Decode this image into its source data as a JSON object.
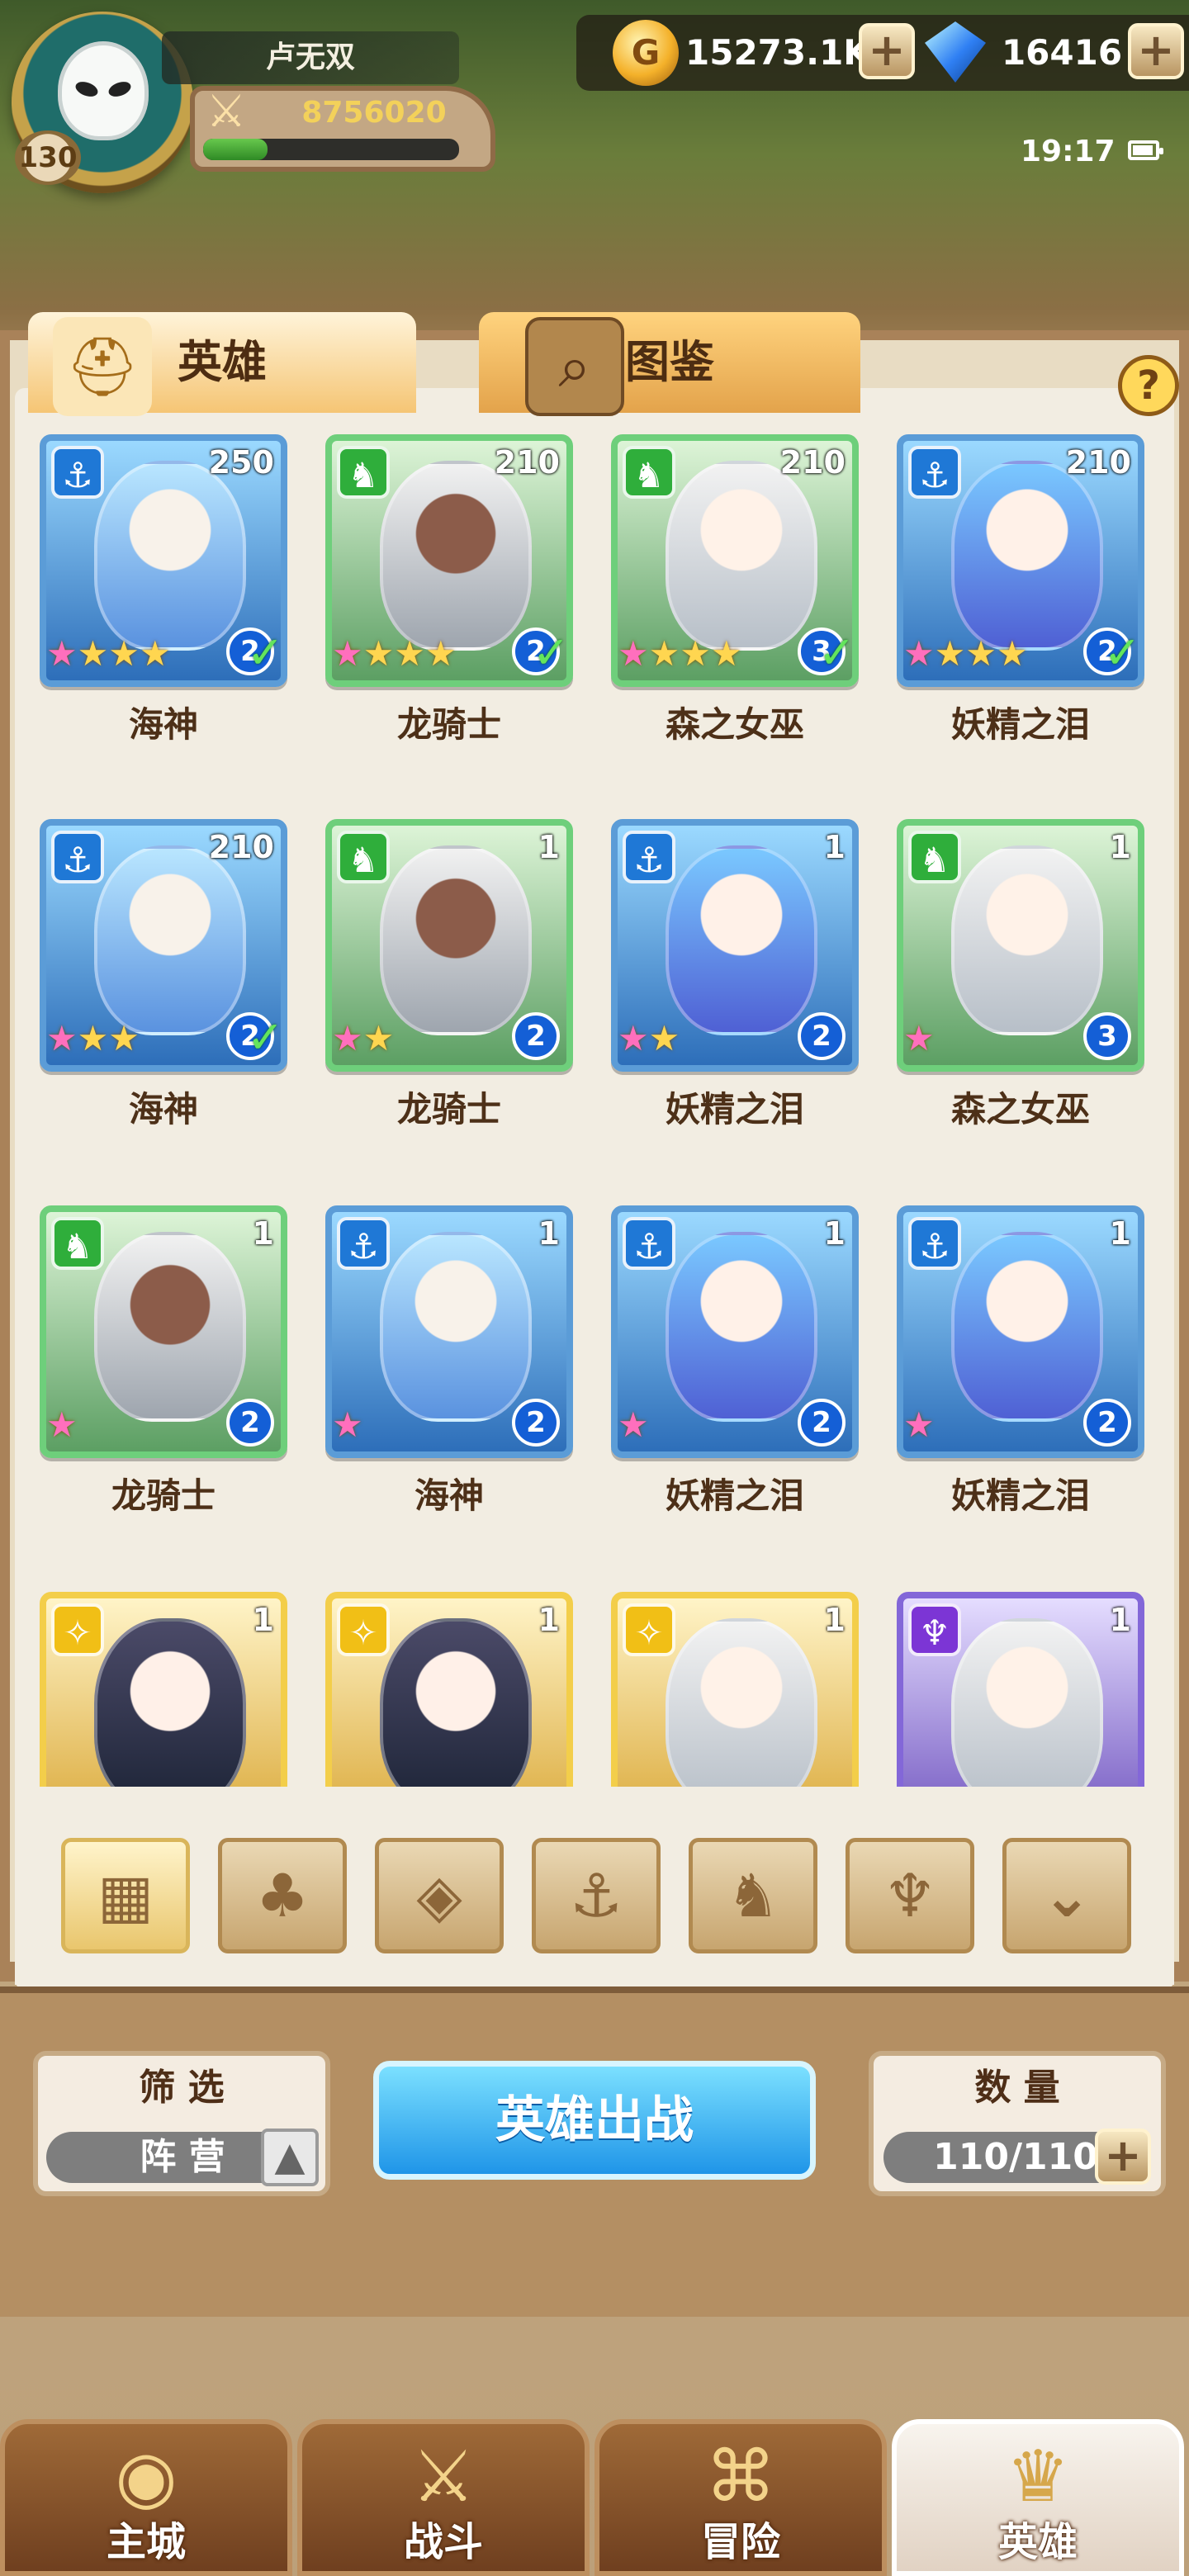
{
  "player": {
    "name": "卢无双",
    "level": "130",
    "power": "8756020",
    "experience_progress": 0.25
  },
  "resources": {
    "gold": "15273.1K",
    "gems": "16416"
  },
  "status": {
    "time": "19:17"
  },
  "tabs": [
    {
      "label": "英雄",
      "active": true
    },
    {
      "label": "图鉴",
      "active": false
    }
  ],
  "heroes": [
    {
      "name": "海神",
      "level": "250",
      "stars": 4,
      "rank": "2",
      "faction": "anchor",
      "checked": true,
      "theme": "blue"
    },
    {
      "name": "龙骑士",
      "level": "210",
      "stars": 4,
      "rank": "2",
      "faction": "beast",
      "checked": true,
      "theme": "dark"
    },
    {
      "name": "森之女巫",
      "level": "210",
      "stars": 4,
      "rank": "3",
      "faction": "beast",
      "checked": true,
      "theme": "white"
    },
    {
      "name": "妖精之泪",
      "level": "210",
      "stars": 4,
      "rank": "2",
      "faction": "anchor",
      "checked": true,
      "theme": "pink"
    },
    {
      "name": "海神",
      "level": "210",
      "stars": 3,
      "rank": "2",
      "faction": "anchor",
      "checked": true,
      "theme": "blue"
    },
    {
      "name": "龙骑士",
      "level": "1",
      "stars": 2,
      "rank": "2",
      "faction": "beast",
      "checked": false,
      "theme": "dark"
    },
    {
      "name": "妖精之泪",
      "level": "1",
      "stars": 2,
      "rank": "2",
      "faction": "anchor",
      "checked": false,
      "theme": "pink"
    },
    {
      "name": "森之女巫",
      "level": "1",
      "stars": 1,
      "rank": "3",
      "faction": "beast",
      "checked": false,
      "theme": "white"
    },
    {
      "name": "龙骑士",
      "level": "1",
      "stars": 1,
      "rank": "2",
      "faction": "beast",
      "checked": false,
      "theme": "dark"
    },
    {
      "name": "海神",
      "level": "1",
      "stars": 1,
      "rank": "2",
      "faction": "anchor",
      "checked": false,
      "theme": "blue"
    },
    {
      "name": "妖精之泪",
      "level": "1",
      "stars": 1,
      "rank": "2",
      "faction": "anchor",
      "checked": false,
      "theme": "pink"
    },
    {
      "name": "妖精之泪",
      "level": "1",
      "stars": 1,
      "rank": "2",
      "faction": "anchor",
      "checked": false,
      "theme": "pink"
    },
    {
      "name": "",
      "level": "1",
      "stars": 0,
      "rank": "",
      "faction": "light",
      "checked": false,
      "theme": "green"
    },
    {
      "name": "",
      "level": "1",
      "stars": 0,
      "rank": "",
      "faction": "light",
      "checked": false,
      "theme": "green"
    },
    {
      "name": "",
      "level": "1",
      "stars": 0,
      "rank": "",
      "faction": "light",
      "checked": false,
      "theme": "white"
    },
    {
      "name": "",
      "level": "1",
      "stars": 0,
      "rank": "",
      "faction": "dark",
      "checked": false,
      "theme": "white"
    }
  ],
  "filter_buttons": [
    {
      "icon": "grid-icon",
      "symbol": "▦",
      "active": true
    },
    {
      "icon": "leaf-icon",
      "symbol": "♣",
      "active": false
    },
    {
      "icon": "diamond-icon",
      "symbol": "◈",
      "active": false
    },
    {
      "icon": "anchor-icon",
      "symbol": "⚓",
      "active": false
    },
    {
      "icon": "beast-icon",
      "symbol": "♞",
      "active": false
    },
    {
      "icon": "horned-icon",
      "symbol": "♆",
      "active": false
    },
    {
      "icon": "wing-icon",
      "symbol": "⌄",
      "active": false
    }
  ],
  "bottom_controls": {
    "filter_label": "筛 选",
    "filter_value": "阵 营",
    "deploy_label": "英雄出战",
    "count_label": "数 量",
    "count_value": "110/110"
  },
  "navigation": [
    {
      "label": "主城",
      "icon": "castle-icon",
      "symbol": "◉",
      "active": false
    },
    {
      "label": "战斗",
      "icon": "crossed-swords-icon",
      "symbol": "⚔",
      "active": false
    },
    {
      "label": "冒险",
      "icon": "map-icon",
      "symbol": "⌘",
      "active": false
    },
    {
      "label": "英雄",
      "icon": "hero-crest-icon",
      "symbol": "♛",
      "active": true
    }
  ],
  "colors": {
    "accent_gold": "#f3d15a",
    "deploy_blue": "#1f95e8",
    "panel_brown": "#a98259"
  }
}
